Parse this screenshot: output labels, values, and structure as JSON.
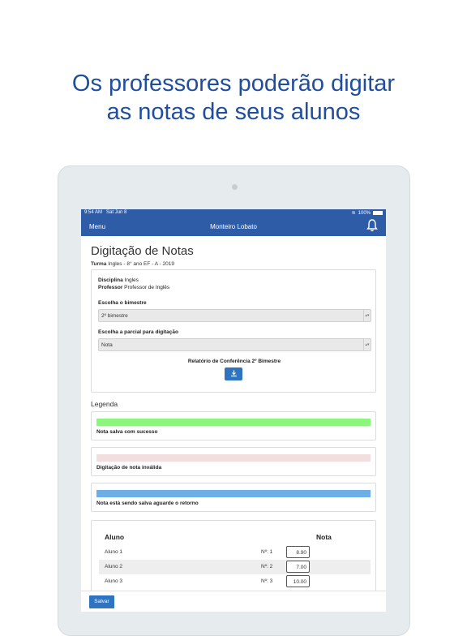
{
  "headline": {
    "line1": "Os professores poderão digitar",
    "line2": "as notas de seus alunos"
  },
  "status_bar": {
    "time": "9:54 AM",
    "date": "Sat Jun 8",
    "battery": "100%"
  },
  "nav": {
    "menu": "Menu",
    "title": "Monteiro Lobato",
    "bell_icon": "bell-icon"
  },
  "page": {
    "title": "Digitação de Notas",
    "turma_label": "Turma",
    "turma_value": "Ingles - 8° ano EF - A - 2019"
  },
  "filters": {
    "disciplina_label": "Disciplina",
    "disciplina_value": "Ingles",
    "professor_label": "Professor",
    "professor_value": "Professor de Inglês",
    "bimestre_label": "Escolha o bimestre",
    "bimestre_value": "2º bimestre",
    "parcial_label": "Escolha a parcial para digitação",
    "parcial_value": "Nota",
    "report_label": "Relatório de Conferência 2º Bimestre",
    "download_icon": "download-icon"
  },
  "legend": {
    "title": "Legenda",
    "items": [
      {
        "color": "#8cf57e",
        "text": "Nota salva com sucesso"
      },
      {
        "color": "#f2dede",
        "text": "Digitação de nota inválida"
      },
      {
        "color": "#6eaee6",
        "text": "Nota está sendo salva aguarde o retorno"
      }
    ]
  },
  "grades": {
    "col_aluno": "Aluno",
    "col_nota": "Nota",
    "rows": [
      {
        "name": "Aluno 1",
        "num": "Nº: 1",
        "grade": "8.90"
      },
      {
        "name": "Aluno 2",
        "num": "Nº: 2",
        "grade": "7.00"
      },
      {
        "name": "Aluno 3",
        "num": "Nº: 3",
        "grade": "10.00"
      }
    ]
  },
  "footer": {
    "save_label": "Salvar"
  },
  "colors": {
    "brand": "#2f5ca6",
    "button": "#2f74c0",
    "headline": "#1f4e9e"
  }
}
